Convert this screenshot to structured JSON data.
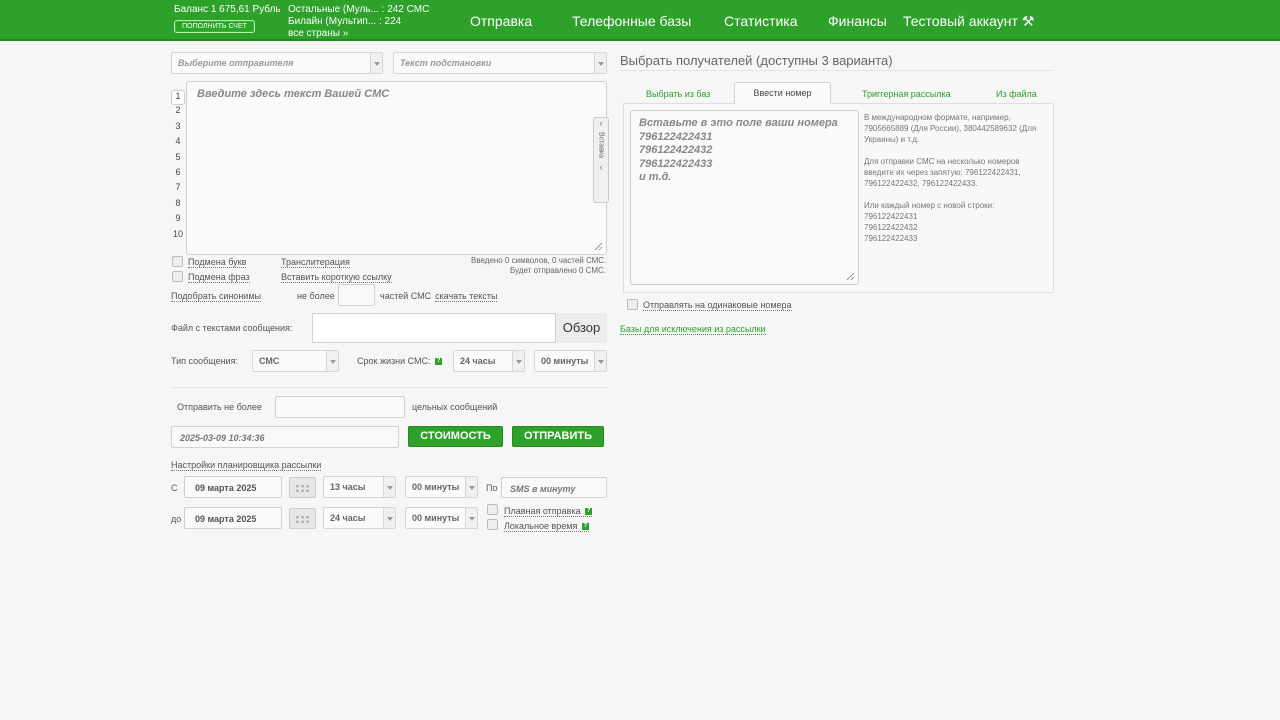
{
  "header": {
    "balance": "Баланс 1 675,61 Рубль",
    "topup_label": "ПОПОЛНИТЬ СЧЕТ",
    "operators": [
      {
        "name": "Остальные (Муль... :",
        "count": "242 СМС"
      },
      {
        "name": "Билайн (Мультип... :",
        "count": "224"
      }
    ],
    "all_countries": "все страны »",
    "nav": [
      "Отправка",
      "Телефонные базы",
      "Статистика",
      "Финансы",
      "Тестовый аккаунт"
    ],
    "tools_icon": "tools-icon"
  },
  "left": {
    "sender_placeholder": "Выберите отправителя",
    "substitution_placeholder": "Текст подстановки",
    "line_numbers": [
      "1",
      "2",
      "3",
      "4",
      "5",
      "6",
      "7",
      "8",
      "9",
      "10"
    ],
    "sms_placeholder": "Введите здесь текст Вашей СМС",
    "side_tab_label": "Вставка",
    "opt_replace_letters": "Подмена букв",
    "opt_transliteration": "Транслитерация",
    "opt_replace_phrases": "Подмена фраз",
    "opt_short_link": "Вставить короткую ссылку",
    "counter_line1": "Введено 0 символов, 0 частей СМС.",
    "counter_line2": "Будет отправлено 0 СМС.",
    "synonyms": "Подобрать синонимы",
    "no_more": "не более",
    "parts_sms": "частей СМС",
    "download_texts": "скачать тексты",
    "file_label": "Файл с текстами сообщения:",
    "browse": "Обзор",
    "msg_type_label": "Тип сообщения:",
    "msg_type_value": "СМС",
    "lifetime_label": "Срок жизни СМС:",
    "lifetime_hours": "24 часы",
    "lifetime_minutes": "00 минуты",
    "send_max_label": "Отправить не более",
    "whole_messages": "цельных сообщений",
    "datetime": "2025-03-09 10:34:36",
    "cost_button": "СТОИМОСТЬ",
    "send_button": "ОТПРАВИТЬ",
    "scheduler_link": "Настройки планировщика рассылки",
    "from_label": "С",
    "to_label": "до",
    "date_from": "09 марта 2025",
    "date_to": "09 марта 2025",
    "from_hours": "13 часы",
    "to_hours": "24 часы",
    "from_minutes": "00 минуты",
    "to_minutes": "00 минуты",
    "per_label": "По",
    "sms_per_min_placeholder": "SMS в минуту",
    "smooth_send": "Плавная отправка",
    "local_time": "Локальное время"
  },
  "right": {
    "title": "Выбрать получателей (доступны 3 варианта)",
    "tabs": [
      "Выбрать из баз",
      "Ввести номер",
      "Триггерная рассылка",
      "Из файла"
    ],
    "active_tab": "Ввести номер",
    "numbers_placeholder": [
      "Вставьте в это поле ваши номера",
      "796122422431",
      "796122422432",
      "796122422433",
      "и т.д."
    ],
    "hint_p1": "В международном формате, например, 7905665889 (Для России), 380442589632 (Для Украины) и т.д.",
    "hint_p2": "Для отправки СМС на несколько номеров введите их через запятую: 796122422431, 796122422432, 796122422433.",
    "hint_p3_title": "Или каждый номер с новой строки:",
    "hint_p3_lines": [
      "796122422431",
      "796122422432",
      "796122422433"
    ],
    "send_duplicates": "Отправлять на одинаковые номера",
    "exclusion_bases": "Базы для исключения из рассылки"
  },
  "colors": {
    "brand_green": "#2ea12b",
    "background": "#f6f6f6"
  }
}
